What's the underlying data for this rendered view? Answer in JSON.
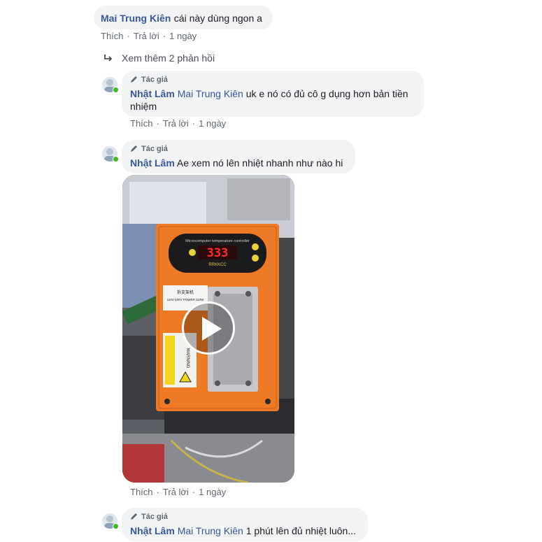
{
  "comments": [
    {
      "name": "Mai Trung Kiên",
      "text": "cái này dùng ngon a",
      "like": "Thích",
      "reply": "Trả lời",
      "time": "1 ngày"
    },
    {
      "author_badge": "Tác giả",
      "name": "Nhật Lâm",
      "tag": "Mai Trung Kiên",
      "text": "uk e nó có đủ cô g dụng hơn bản tiền nhiệm",
      "like": "Thích",
      "reply": "Trả lời",
      "time": "1 ngày"
    },
    {
      "author_badge": "Tác giả",
      "name": "Nhật Lâm",
      "text": "Ae xem nó lên nhiệt nhanh như nào hi",
      "like": "Thích",
      "reply": "Trả lời",
      "time": "1 ngày"
    },
    {
      "author_badge": "Tác giả",
      "name": "Nhật Lâm",
      "tag": "Mai Trung Kiên",
      "text": "1 phút lên đủ nhiệt luôn..."
    }
  ],
  "more_replies": "Xem thêm 2 phản hồi",
  "video": {
    "device_title": "Microcomputer temperature controller",
    "display": "333",
    "brand": "RRKKCC",
    "spec_line1": "拆支架机",
    "spec_line2": "110V-220V  POWER:110W",
    "warning": "WARNING",
    "icons": [
      "play-icon"
    ]
  },
  "colors": {
    "link": "#385898",
    "bubble": "#f2f3f5",
    "meta": "#606770",
    "online": "#42b72a",
    "device": "#ee7a26"
  }
}
